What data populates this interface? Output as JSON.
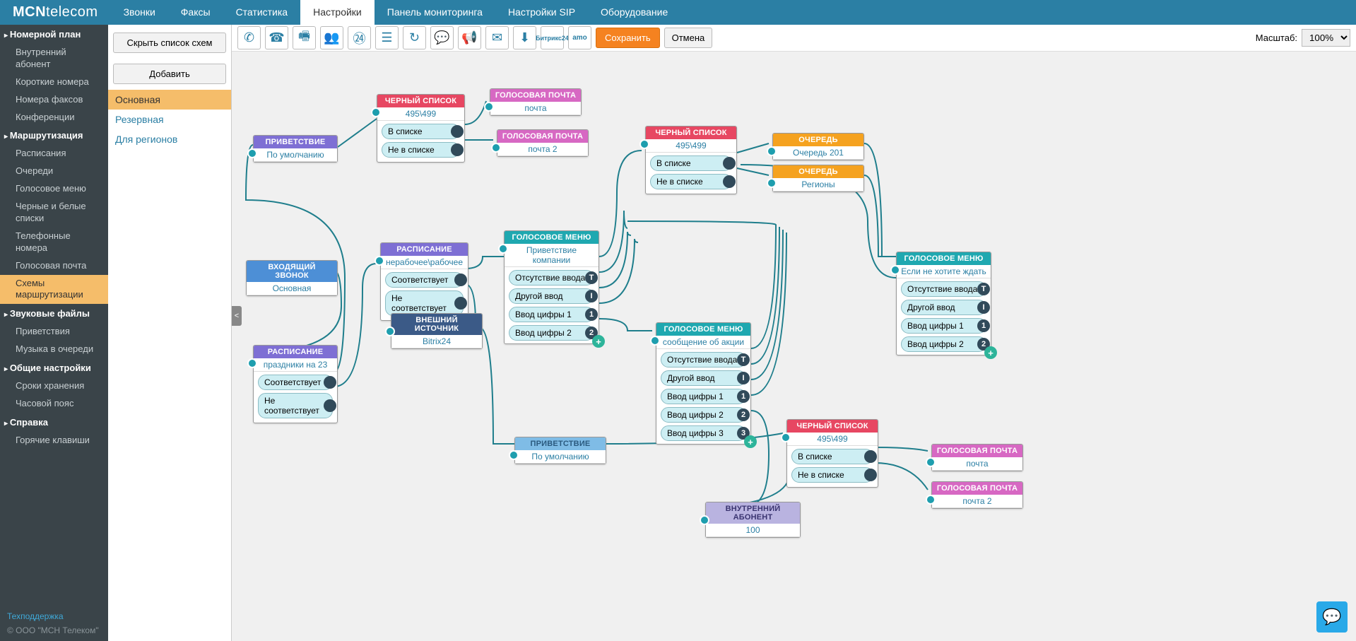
{
  "brand": {
    "main": "MCN",
    "thin": "telecom"
  },
  "topnav": [
    "Звонки",
    "Факсы",
    "Статистика",
    "Настройки",
    "Панель мониторинга",
    "Настройки SIP",
    "Оборудование"
  ],
  "topnav_active": 3,
  "sidebar": [
    {
      "title": "Номерной план",
      "items": [
        "Внутренний абонент",
        "Короткие номера",
        "Номера факсов",
        "Конференции"
      ]
    },
    {
      "title": "Маршрутизация",
      "items": [
        "Расписания",
        "Очереди",
        "Голосовое меню",
        "Черные и белые списки",
        "Телефонные номера",
        "Голосовая почта",
        "Схемы маршрутизации"
      ],
      "active": 6
    },
    {
      "title": "Звуковые файлы",
      "items": [
        "Приветствия",
        "Музыка в очереди"
      ]
    },
    {
      "title": "Общие настройки",
      "items": [
        "Сроки хранения",
        "Часовой пояс"
      ]
    },
    {
      "title": "Справка",
      "items": [
        "Горячие клавиши"
      ]
    }
  ],
  "sidebar_footer": {
    "support": "Техподдержка",
    "copy": "© ООО \"МСН Телеком\""
  },
  "scheme_panel": {
    "hide_btn": "Скрыть список схем",
    "add_btn": "Добавить",
    "items": [
      "Основная",
      "Резервная",
      "Для регионов"
    ],
    "active": 0
  },
  "toolbar": {
    "save": "Сохранить",
    "cancel": "Отмена",
    "zoom_label": "Масштаб:",
    "zoom_value": "100%",
    "collapse": "<"
  },
  "nodes": {
    "greet1": {
      "title": "ПРИВЕТСТВИЕ",
      "sub": "По умолчанию"
    },
    "black1": {
      "title": "ЧЕРНЫЙ СПИСОК",
      "sub": "495\\499",
      "o1": "В списке",
      "o2": "Не в списке"
    },
    "vm1": {
      "title": "ГОЛОСОВАЯ ПОЧТА",
      "sub": "почта"
    },
    "vm2": {
      "title": "ГОЛОСОВАЯ ПОЧТА",
      "sub": "почта 2"
    },
    "black2": {
      "title": "ЧЕРНЫЙ СПИСОК",
      "sub": "495\\499",
      "o1": "В списке",
      "o2": "Не в списке"
    },
    "queue1": {
      "title": "ОЧЕРЕДЬ",
      "sub": "Очередь 201"
    },
    "queue2": {
      "title": "ОЧЕРЕДЬ",
      "sub": "Регионы"
    },
    "incoming": {
      "title": "ВХОДЯЩИЙ ЗВОНОК",
      "sub": "Основная"
    },
    "sched1": {
      "title": "РАСПИСАНИЕ",
      "sub": "нерабочее\\рабочее",
      "o1": "Соответствует",
      "o2": "Не соответствует"
    },
    "ivr1": {
      "title": "ГОЛОСОВОЕ МЕНЮ",
      "sub": "Приветствие компании",
      "o1": "Отсутствие ввода",
      "b1": "T",
      "o2": "Другой ввод",
      "b2": "I",
      "o3": "Ввод цифры 1",
      "b3": "1",
      "o4": "Ввод цифры 2",
      "b4": "2"
    },
    "ext": {
      "title": "ВНЕШНИЙ ИСТОЧНИК",
      "sub": "Bitrix24"
    },
    "sched2": {
      "title": "РАСПИСАНИЕ",
      "sub": "праздники на 23",
      "o1": "Соответствует",
      "o2": "Не соответствует"
    },
    "ivr2": {
      "title": "ГОЛОСОВОЕ МЕНЮ",
      "sub": "сообщение об акции",
      "o1": "Отсутствие ввода",
      "b1": "T",
      "o2": "Другой ввод",
      "b2": "I",
      "o3": "Ввод цифры 1",
      "b3": "1",
      "o4": "Ввод цифры 2",
      "b4": "2",
      "o5": "Ввод цифры 3",
      "b5": "3"
    },
    "ivr3": {
      "title": "ГОЛОСОВОЕ МЕНЮ",
      "sub": "Если не хотите ждать",
      "o1": "Отсутствие ввода",
      "b1": "T",
      "o2": "Другой ввод",
      "b2": "I",
      "o3": "Ввод цифры 1",
      "b3": "1",
      "o4": "Ввод цифры 2",
      "b4": "2"
    },
    "greet2": {
      "title": "ПРИВЕТСТВИЕ",
      "sub": "По умолчанию"
    },
    "black3": {
      "title": "ЧЕРНЫЙ СПИСОК",
      "sub": "495\\499",
      "o1": "В списке",
      "o2": "Не в списке"
    },
    "vm3": {
      "title": "ГОЛОСОВАЯ ПОЧТА",
      "sub": "почта"
    },
    "vm4": {
      "title": "ГОЛОСОВАЯ ПОЧТА",
      "sub": "почта 2"
    },
    "abon": {
      "title": "ВНУТРЕННИЙ АБОНЕНТ",
      "sub": "100"
    }
  }
}
